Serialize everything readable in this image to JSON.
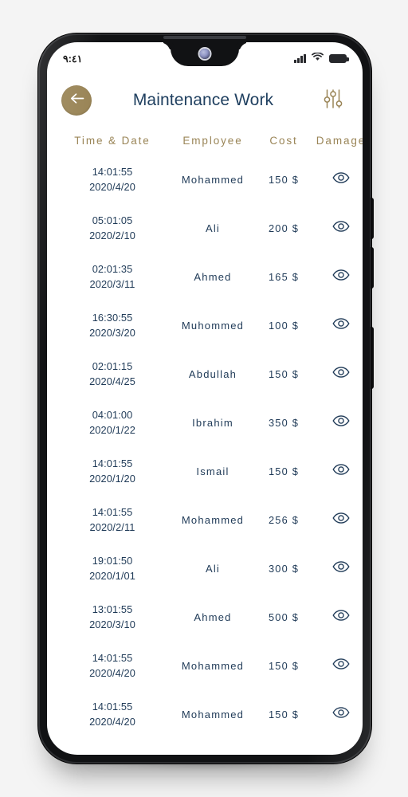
{
  "status_bar": {
    "time": "٩:٤١",
    "signal_icon": "signal-bars-icon",
    "wifi_icon": "wifi-icon",
    "battery_icon": "battery-icon"
  },
  "app_bar": {
    "back_icon": "arrow-left-icon",
    "title": "Maintenance Work",
    "filter_icon": "filter-sliders-icon"
  },
  "colors": {
    "accent_gold": "#9a8557",
    "text_navy": "#1f3a57",
    "title_navy": "#204060",
    "screen_bg": "#ffffff",
    "frame_black": "#111214",
    "page_bg": "#f4f4f4"
  },
  "table": {
    "columns": [
      "Time & Date",
      "Employee",
      "Cost",
      "Damage"
    ],
    "rows": [
      {
        "time": "14:01:55",
        "date": "2020/4/20",
        "employee": "Mohammed",
        "cost": "150 $",
        "damage_icon": "eye-icon"
      },
      {
        "time": "05:01:05",
        "date": "2020/2/10",
        "employee": "Ali",
        "cost": "200 $",
        "damage_icon": "eye-icon"
      },
      {
        "time": "02:01:35",
        "date": "2020/3/11",
        "employee": "Ahmed",
        "cost": "165 $",
        "damage_icon": "eye-icon"
      },
      {
        "time": "16:30:55",
        "date": "2020/3/20",
        "employee": "Muhommed",
        "cost": "100 $",
        "damage_icon": "eye-icon"
      },
      {
        "time": "02:01:15",
        "date": "2020/4/25",
        "employee": "Abdullah",
        "cost": "150 $",
        "damage_icon": "eye-icon"
      },
      {
        "time": "04:01:00",
        "date": "2020/1/22",
        "employee": "Ibrahim",
        "cost": "350 $",
        "damage_icon": "eye-icon"
      },
      {
        "time": "14:01:55",
        "date": "2020/1/20",
        "employee": "Ismail",
        "cost": "150 $",
        "damage_icon": "eye-icon"
      },
      {
        "time": "14:01:55",
        "date": "2020/2/11",
        "employee": "Mohammed",
        "cost": "256 $",
        "damage_icon": "eye-icon"
      },
      {
        "time": "19:01:50",
        "date": "2020/1/01",
        "employee": "Ali",
        "cost": "300 $",
        "damage_icon": "eye-icon"
      },
      {
        "time": "13:01:55",
        "date": "2020/3/10",
        "employee": "Ahmed",
        "cost": "500 $",
        "damage_icon": "eye-icon"
      },
      {
        "time": "14:01:55",
        "date": "2020/4/20",
        "employee": "Mohammed",
        "cost": "150 $",
        "damage_icon": "eye-icon"
      },
      {
        "time": "14:01:55",
        "date": "2020/4/20",
        "employee": "Mohammed",
        "cost": "150 $",
        "damage_icon": "eye-icon"
      }
    ]
  },
  "device": {
    "hardware_buttons": [
      "volume-up",
      "volume-down",
      "power"
    ],
    "notch": "waterdrop-notch",
    "camera": "front-camera"
  }
}
